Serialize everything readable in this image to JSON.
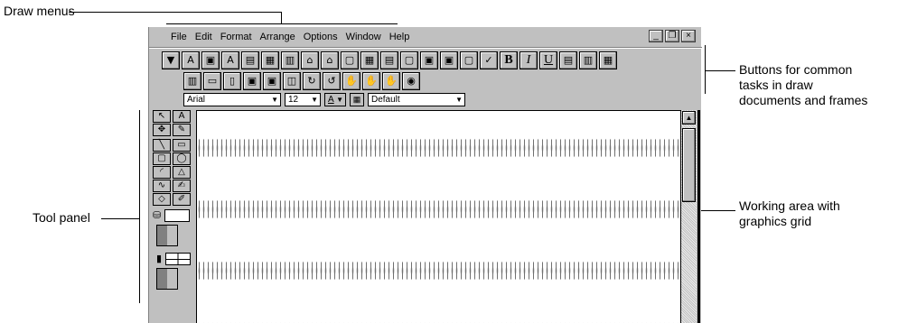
{
  "callouts": {
    "draw_menus": "Draw menus",
    "buttons": [
      "Buttons for common",
      "tasks in draw",
      "documents and frames"
    ],
    "tool_panel": "Tool panel",
    "working_area": [
      "Working area with",
      "graphics grid"
    ]
  },
  "menubar": {
    "items": [
      "File",
      "Edit",
      "Format",
      "Arrange",
      "Options",
      "Window",
      "Help"
    ]
  },
  "window_controls": [
    "_",
    "❐",
    "×"
  ],
  "toolbar": {
    "row1": [
      "▼",
      "A",
      "▣",
      "A",
      "▤",
      "▦",
      "▥",
      "⌂",
      "⌂",
      "▢",
      "▦",
      "▤",
      "▢",
      "▣",
      "▣",
      "▢",
      "✓",
      "B",
      "I",
      "U",
      "▤",
      "▥",
      "▦"
    ],
    "row2": [
      "▥",
      "▭",
      "▯",
      "▣",
      "▣",
      "◫",
      "↻",
      "↺",
      "✋",
      "✋",
      "✋",
      "◉"
    ]
  },
  "format_bar": {
    "font": "Arial",
    "size": "12",
    "color_label": "A",
    "style": "Default"
  },
  "tools": [
    "↖",
    "A",
    "✥",
    "✎",
    "╲",
    "▭",
    "▢",
    "◯",
    "◜",
    "△",
    "∿",
    "✍",
    "◇",
    "✐"
  ]
}
